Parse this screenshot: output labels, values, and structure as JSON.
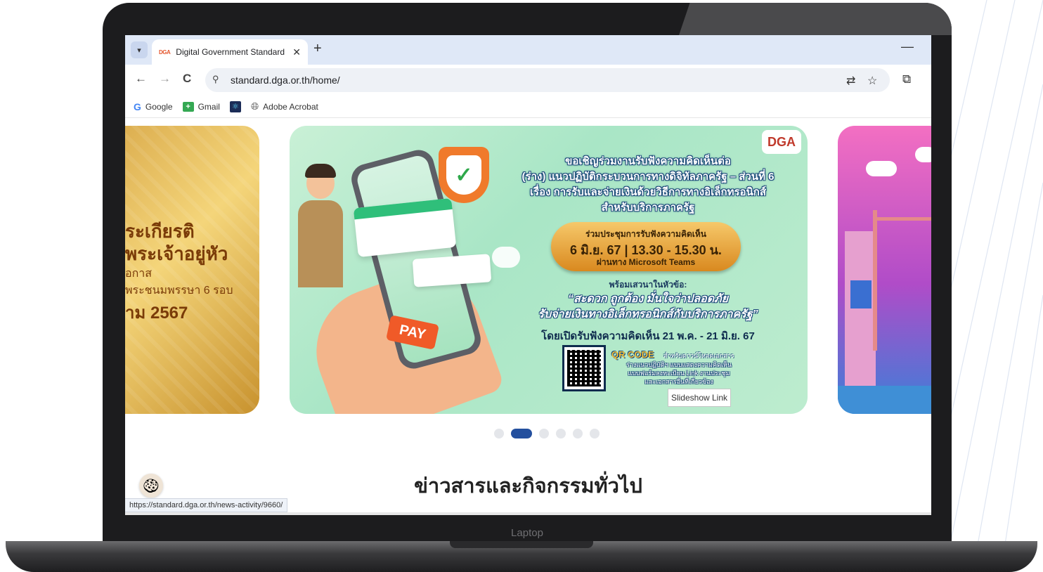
{
  "device": {
    "label": "Laptop"
  },
  "browser": {
    "tab_dropdown_icon": "chevron-down-icon",
    "tab": {
      "favicon_text": "DGA",
      "title": "Digital Government Standard -",
      "close_icon": "close-icon"
    },
    "new_tab_icon": "plus-icon",
    "minimize_icon": "minimize-icon",
    "nav": {
      "back": "←",
      "forward": "→",
      "reload": "C"
    },
    "address": {
      "site_info_icon": "tune-icon",
      "url": "standard.dga.or.th/home/"
    },
    "translate_icon": "translate-icon",
    "bookmark_star_icon": "star-icon",
    "extensions_icon": "puzzle-icon",
    "bookmarks": [
      {
        "label": "Google",
        "icon": "google-icon"
      },
      {
        "label": "Gmail",
        "icon": "gmail-icon"
      },
      {
        "label": "",
        "icon": "react-icon"
      },
      {
        "label": "Adobe Acrobat",
        "icon": "globe-icon"
      }
    ]
  },
  "carousel": {
    "left_slide": {
      "line1": "ระเกียรติ",
      "line2": "พระเจ้าอยู่หัว",
      "line3": "อกาส",
      "line4": "พระชนมพรรษา 6 รอบ",
      "line5": "าม 2567"
    },
    "main_slide": {
      "logo": "DGA",
      "heading": [
        "ขอเชิญร่วมงานรับฟังความคิดเห็นต่อ",
        "(ร่าง) แนวปฏิบัติกระบวนการทางดิจิทัลภาครัฐ – ส่วนที่ 6",
        "เรื่อง การรับและจ่ายเงินด้วยวิธีการทางอิเล็กทรอนิกส์",
        "สำหรับบริการภาครัฐ"
      ],
      "meeting_label": "ร่วมประชุมการรับฟังความคิดเห็น",
      "meeting_time": "6 มิ.ย. 67 | 13.30 - 15.30 น.",
      "meeting_via": "ผ่านทาง Microsoft Teams",
      "topic_label": "พร้อมเสวนาในหัวข้อ:",
      "topic_line1": "“สะดวก ถูกต้อง มั่นใจว่าปลอดภัย",
      "topic_line2": "รับจ่ายเงินทางอิเล็กทรอนิกส์กับบริการภาครัฐ”",
      "period": "โดยเปิดรับฟังความคิดเห็น 21 พ.ค. - 21 มิ.ย. 67",
      "qr_title": "QR CODE",
      "qr_title_suffix": "สำหรับดาวน์โหลดเอกสาร",
      "qr_desc": [
        "ร่างแนวปฏิบัติฯ แบบแสดงความคิดเห็น",
        "แบบฟอร์มลงทะเบียน Link งานประชุม",
        "และเอกสารอื่นที่เกี่ยวข้อง"
      ],
      "pay_text": "PAY"
    },
    "tooltip": "Slideshow Link",
    "dots": 6,
    "active_dot": 1
  },
  "section_title": "ข่าวสารและกิจกรรมทั่วไป",
  "status_url": "https://standard.dga.or.th/news-activity/9660/",
  "cookie_icon": "cookie-icon"
}
